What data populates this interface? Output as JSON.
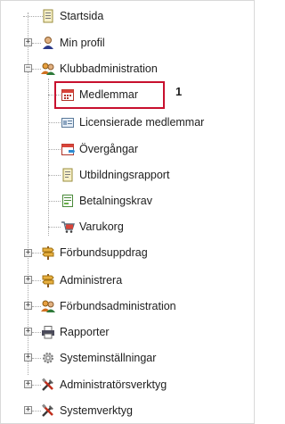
{
  "tree": {
    "items": [
      {
        "label": "Startsida",
        "icon": "document-icon",
        "expander": ""
      },
      {
        "label": "Min profil",
        "icon": "user-icon",
        "expander": "+"
      },
      {
        "label": "Klubbadministration",
        "icon": "users-group-icon",
        "expander": "−"
      },
      {
        "label": "Medlemmar",
        "icon": "calendar-icon",
        "expander": ""
      },
      {
        "label": "Licensierade medlemmar",
        "icon": "id-card-icon",
        "expander": ""
      },
      {
        "label": "Övergångar",
        "icon": "calendar-move-icon",
        "expander": ""
      },
      {
        "label": "Utbildningsrapport",
        "icon": "report-document-icon",
        "expander": ""
      },
      {
        "label": "Betalningskrav",
        "icon": "invoice-icon",
        "expander": ""
      },
      {
        "label": "Varukorg",
        "icon": "shopping-cart-icon",
        "expander": ""
      },
      {
        "label": "Förbundsuppdrag",
        "icon": "signpost-icon",
        "expander": "+"
      },
      {
        "label": "Administrera",
        "icon": "signpost-icon",
        "expander": "+"
      },
      {
        "label": "Förbundsadministration",
        "icon": "users-group-icon",
        "expander": "+"
      },
      {
        "label": "Rapporter",
        "icon": "printer-icon",
        "expander": "+"
      },
      {
        "label": "Systeminställningar",
        "icon": "gear-icon",
        "expander": "+"
      },
      {
        "label": "Administratörsverktyg",
        "icon": "tools-icon",
        "expander": "+"
      },
      {
        "label": "Systemverktyg",
        "icon": "tools-icon",
        "expander": "+"
      }
    ]
  },
  "annotation": {
    "number": "1"
  },
  "colors": {
    "highlight_border": "#c8102e"
  }
}
